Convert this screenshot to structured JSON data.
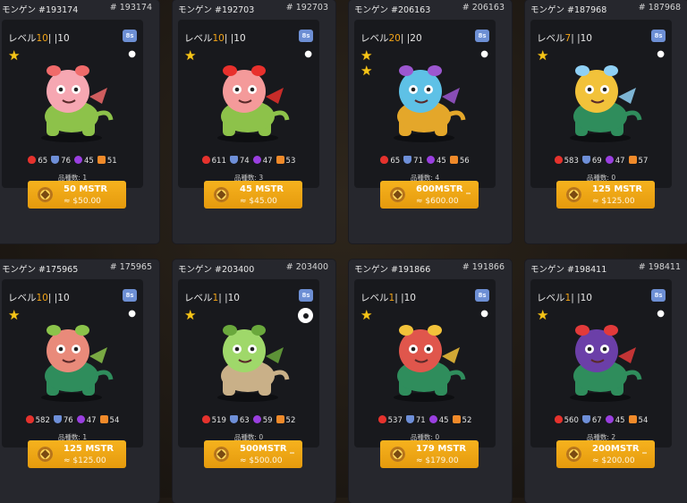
{
  "cards": [
    {
      "title": "モンゲン #193174",
      "id": "# 193174",
      "level_prefix": "レベル",
      "level": "10",
      "level_max": "| |10",
      "stars": 1,
      "badge": "8s",
      "type": "paw",
      "stats": {
        "hp": "65",
        "def": "76",
        "mag": "45",
        "agi": "51"
      },
      "breeds": "品種数: 1",
      "price": "50 MSTR",
      "usd": "≈ $50.00",
      "colors": {
        "body": "#8dc24a",
        "head": "#f6a7b2",
        "accent": "#f06a6a"
      }
    },
    {
      "title": "モンゲン #192703",
      "id": "# 192703",
      "level_prefix": "レベル",
      "level": "10",
      "level_max": "| |10",
      "stars": 1,
      "badge": "8s",
      "type": "paw",
      "stats": {
        "hp": "611",
        "def": "74",
        "mag": "47",
        "agi": "53"
      },
      "breeds": "品種数: 3",
      "price": "45 MSTR",
      "usd": "≈ $45.00",
      "colors": {
        "body": "#8dc24a",
        "head": "#f49a9a",
        "accent": "#e8302c"
      }
    },
    {
      "title": "モンゲン #206163",
      "id": "# 206163",
      "level_prefix": "レベル",
      "level": "20",
      "level_max": "| |20",
      "stars": 2,
      "badge": "8s",
      "type": "paw",
      "stats": {
        "hp": "65",
        "def": "71",
        "mag": "45",
        "agi": "56"
      },
      "breeds": "品種数: 4",
      "price": "600MSTR _",
      "usd": "≈ $600.00",
      "colors": {
        "body": "#e4a72a",
        "head": "#5ec1e6",
        "accent": "#9c57d0"
      }
    },
    {
      "title": "モンゲン #187968",
      "id": "# 187968",
      "level_prefix": "レベル",
      "level": "7",
      "level_max": "| |10",
      "stars": 1,
      "badge": "8s",
      "type": "paw",
      "stats": {
        "hp": "583",
        "def": "69",
        "mag": "47",
        "agi": "57"
      },
      "breeds": "品種数: 0",
      "price": "125 MSTR",
      "usd": "≈ $125.00",
      "colors": {
        "body": "#2f8d5c",
        "head": "#f2c23a",
        "accent": "#8fd0f5"
      }
    },
    {
      "title": "モンゲン #175965",
      "id": "# 175965",
      "level_prefix": "レベル",
      "level": "10",
      "level_max": "| |10",
      "stars": 1,
      "badge": "8s",
      "type": "paw",
      "stats": {
        "hp": "582",
        "def": "76",
        "mag": "47",
        "agi": "54"
      },
      "breeds": "品種数: 1",
      "price": "125 MSTR",
      "usd": "≈ $125.00",
      "colors": {
        "body": "#2f8d5c",
        "head": "#e98a7a",
        "accent": "#8bc34a"
      }
    },
    {
      "title": "モンゲン #203400",
      "id": "# 203400",
      "level_prefix": "レベル",
      "level": "1",
      "level_max": "| |10",
      "stars": 1,
      "badge": "8s",
      "type": "gear",
      "stats": {
        "hp": "519",
        "def": "63",
        "mag": "59",
        "agi": "52"
      },
      "breeds": "品種数: 0",
      "price": "500MSTR _",
      "usd": "≈ $500.00",
      "colors": {
        "body": "#c9b088",
        "head": "#9fd86a",
        "accent": "#6aa83c"
      }
    },
    {
      "title": "モンゲン #191866",
      "id": "# 191866",
      "level_prefix": "レベル",
      "level": "1",
      "level_max": "| |10",
      "stars": 1,
      "badge": "8s",
      "type": "paw",
      "stats": {
        "hp": "537",
        "def": "71",
        "mag": "45",
        "agi": "52"
      },
      "breeds": "品種数: 0",
      "price": "179 MSTR",
      "usd": "≈ $179.00",
      "colors": {
        "body": "#2f8d5c",
        "head": "#e0564c",
        "accent": "#f2c23a"
      }
    },
    {
      "title": "モンゲン #198411",
      "id": "# 198411",
      "level_prefix": "レベル",
      "level": "1",
      "level_max": "| |10",
      "stars": 1,
      "badge": "8s",
      "type": "paw",
      "stats": {
        "hp": "560",
        "def": "67",
        "mag": "45",
        "agi": "54"
      },
      "breeds": "品種数: 2",
      "price": "200MSTR _",
      "usd": "≈ $200.00",
      "colors": {
        "body": "#2f8d5c",
        "head": "#6b3fa8",
        "accent": "#e23a3a"
      }
    }
  ]
}
